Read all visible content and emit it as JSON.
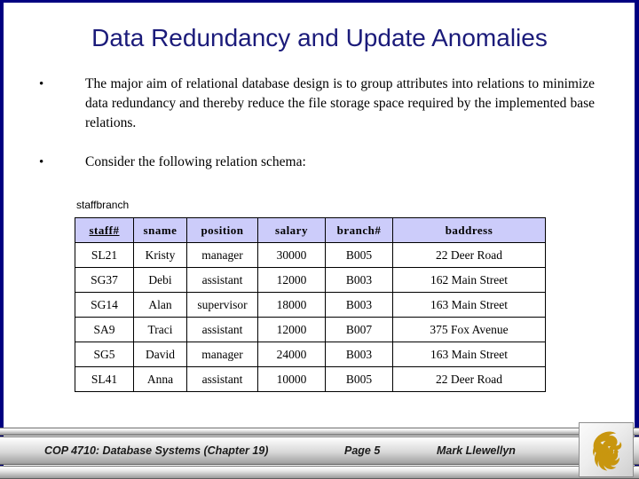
{
  "slide": {
    "title": "Data Redundancy and Update Anomalies",
    "border_color": "#000080",
    "title_color": "#1b1b7a"
  },
  "bullets": [
    {
      "marker": "•",
      "text": "The major aim of relational database design is to group attributes into relations to minimize data redundancy and thereby reduce the file storage space required by the implemented base relations."
    },
    {
      "marker": "•",
      "text": "Consider the following relation schema:"
    }
  ],
  "relation": {
    "name": "staffbranch",
    "header_bg": "#ccccfa",
    "columns": [
      {
        "label": "staff#",
        "primary_key": true
      },
      {
        "label": "sname",
        "primary_key": false
      },
      {
        "label": "position",
        "primary_key": false
      },
      {
        "label": "salary",
        "primary_key": false
      },
      {
        "label": "branch#",
        "primary_key": false
      },
      {
        "label": "baddress",
        "primary_key": false
      }
    ],
    "rows": [
      [
        "SL21",
        "Kristy",
        "manager",
        "30000",
        "B005",
        "22 Deer Road"
      ],
      [
        "SG37",
        "Debi",
        "assistant",
        "12000",
        "B003",
        "162 Main Street"
      ],
      [
        "SG14",
        "Alan",
        "supervisor",
        "18000",
        "B003",
        "163 Main Street"
      ],
      [
        "SA9",
        "Traci",
        "assistant",
        "12000",
        "B007",
        "375 Fox Avenue"
      ],
      [
        "SG5",
        "David",
        "manager",
        "24000",
        "B003",
        "163 Main Street"
      ],
      [
        "SL41",
        "Anna",
        "assistant",
        "10000",
        "B005",
        "22 Deer Road"
      ]
    ]
  },
  "footer": {
    "course": "COP 4710: Database Systems  (Chapter 19)",
    "page": "Page 5",
    "author": "Mark Llewellyn",
    "logo_name": "ucf-pegasus-logo",
    "logo_color": "#c8960f"
  }
}
